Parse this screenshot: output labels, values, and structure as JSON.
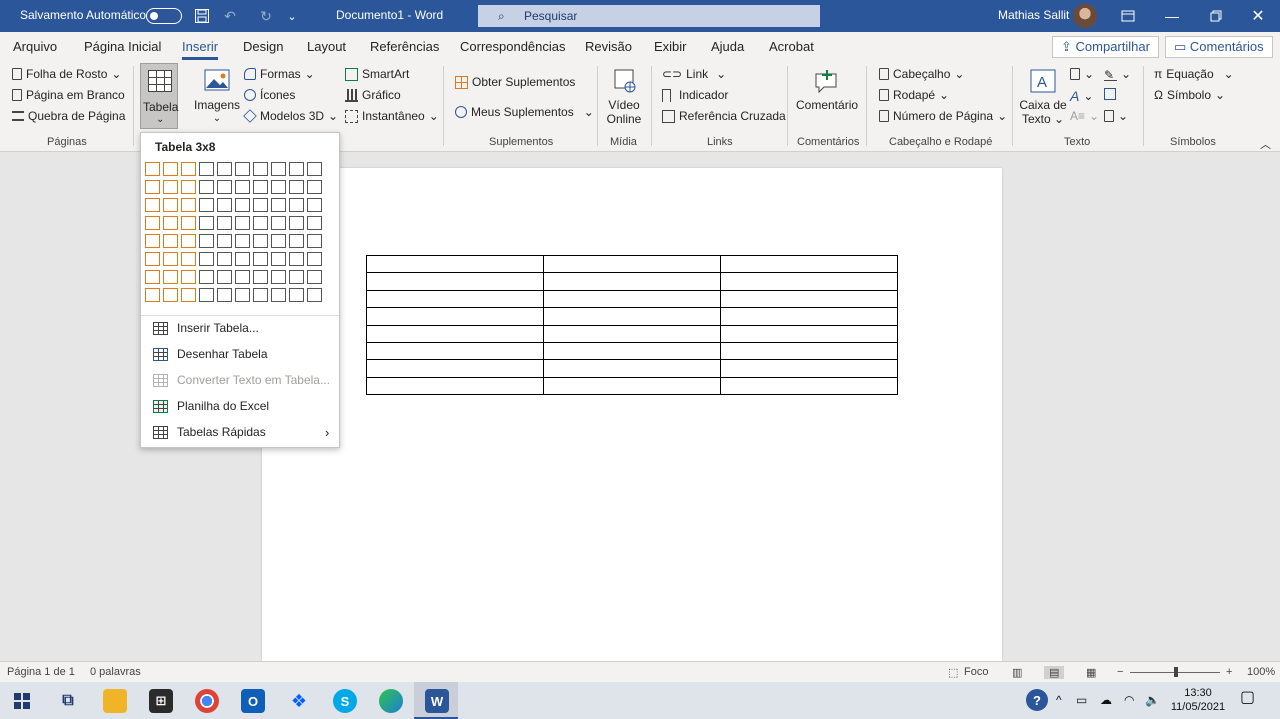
{
  "titlebar": {
    "autosave_label": "Salvamento Automático",
    "doc_title": "Documento1  -  Word",
    "search_placeholder": "Pesquisar",
    "user_name": "Mathias Sallit"
  },
  "tabs": [
    "Arquivo",
    "Página Inicial",
    "Inserir",
    "Design",
    "Layout",
    "Referências",
    "Correspondências",
    "Revisão",
    "Exibir",
    "Ajuda",
    "Acrobat"
  ],
  "active_tab": "Inserir",
  "share_label": "Compartilhar",
  "comments_label": "Comentários",
  "ribbon": {
    "paginas": {
      "items": [
        "Folha de Rosto",
        "Página em Branco",
        "Quebra de Página"
      ],
      "group_label": "Páginas"
    },
    "tabela": {
      "label": "Tabela"
    },
    "imagens": {
      "label": "Imagens"
    },
    "ilustracoes": {
      "items": [
        "Formas",
        "Ícones",
        "Modelos 3D",
        "SmartArt",
        "Gráfico",
        "Instantâneo"
      ]
    },
    "suplementos": {
      "items": [
        "Obter Suplementos",
        "Meus Suplementos"
      ],
      "group_label": "Suplementos"
    },
    "midia": {
      "line1": "Vídeo",
      "line2": "Online",
      "group_label": "Mídia"
    },
    "links": {
      "items": [
        "Link",
        "Indicador",
        "Referência Cruzada"
      ],
      "group_label": "Links"
    },
    "comentarios": {
      "label": "Comentário",
      "group_label": "Comentários"
    },
    "cabecalho": {
      "items": [
        "Cabeçalho",
        "Rodapé",
        "Número de Página"
      ],
      "group_label": "Cabeçalho e Rodapé"
    },
    "texto": {
      "line1": "Caixa de",
      "line2": "Texto",
      "group_label": "Texto"
    },
    "simbolos": {
      "items": [
        "Equação",
        "Símbolo"
      ],
      "group_label": "Símbolos"
    }
  },
  "table_menu": {
    "title": "Tabela 3x8",
    "grid_cols": 10,
    "grid_rows": 8,
    "selected_cols": 3,
    "selected_rows": 8,
    "items": [
      {
        "label": "Inserir Tabela...",
        "enabled": true
      },
      {
        "label": "Desenhar Tabela",
        "enabled": true
      },
      {
        "label": "Converter Texto em Tabela...",
        "enabled": false
      },
      {
        "label": "Planilha do Excel",
        "enabled": true
      },
      {
        "label": "Tabelas Rápidas",
        "enabled": true
      }
    ]
  },
  "document_table": {
    "cols": 3,
    "rows": 8
  },
  "statusbar": {
    "page": "Página 1 de 1",
    "words": "0 palavras",
    "focus": "Foco",
    "zoom": "100%"
  },
  "taskbar": {
    "time": "13:30",
    "date": "11/05/2021"
  }
}
